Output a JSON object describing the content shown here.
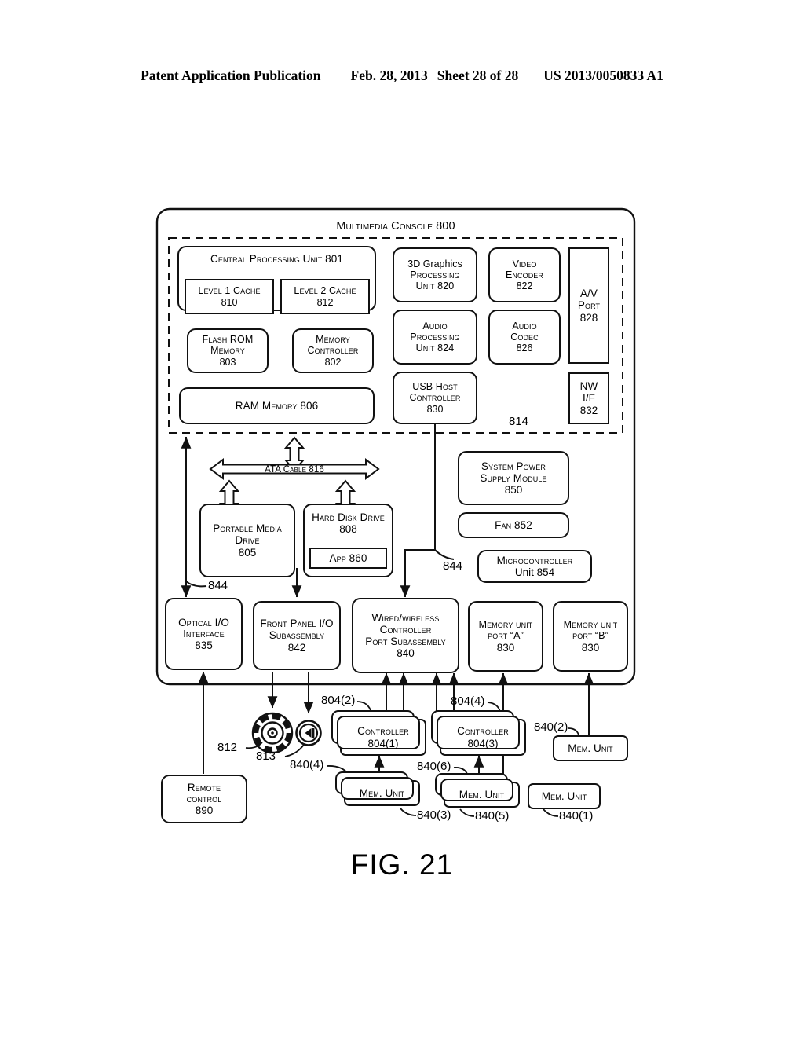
{
  "header": {
    "publication": "Patent Application Publication",
    "date": "Feb. 28, 2013",
    "sheet": "Sheet 28 of 28",
    "docnum": "US 2013/0050833 A1"
  },
  "figure": {
    "caption": "FIG. 21"
  },
  "diagram": {
    "title": "Multimedia Console 800",
    "soc_label": "814",
    "boxes": {
      "cpu": {
        "l1": "Central Processing Unit 801"
      },
      "l1cache": {
        "l1": "Level 1 Cache",
        "l2": "810"
      },
      "l2cache": {
        "l1": "Level 2 Cache",
        "l2": "812"
      },
      "flashrom": {
        "l1": "Flash ROM",
        "l2": "Memory",
        "l3": "803"
      },
      "memctrl": {
        "l1": "Memory",
        "l2": "Controller",
        "l3": "802"
      },
      "ram": {
        "l1": "RAM Memory 806"
      },
      "gpu": {
        "l1": "3D Graphics",
        "l2": "Processing",
        "l3": "Unit 820"
      },
      "videoenc": {
        "l1": "Video",
        "l2": "Encoder",
        "l3": "822"
      },
      "audioproc": {
        "l1": "Audio",
        "l2": "Processing",
        "l3": "Unit 824"
      },
      "audiocodec": {
        "l1": "Audio",
        "l2": "Codec",
        "l3": "826"
      },
      "usbhost": {
        "l1": "USB Host",
        "l2": "Controller",
        "l3": "830"
      },
      "avport": {
        "l1": "A/V",
        "l2": "Port",
        "l3": "828"
      },
      "nwif": {
        "l1": "NW",
        "l2": "I/F",
        "l3": "832"
      },
      "atacable": {
        "l1": "ATA Cable 816"
      },
      "pmd": {
        "l1": "Portable Media",
        "l2": "Drive",
        "l3": "805"
      },
      "hdd": {
        "l1": "Hard Disk Drive",
        "l2": "808"
      },
      "app": {
        "l1": "App 860"
      },
      "psu": {
        "l1": "System Power",
        "l2": "Supply Module",
        "l3": "850"
      },
      "fan": {
        "l1": "Fan 852"
      },
      "mcu": {
        "l1": "Microcontroller",
        "l2": "Unit 854"
      },
      "optical": {
        "l1": "Optical I/O",
        "l2": "Interface",
        "l3": "835"
      },
      "frontpanel": {
        "l1": "Front Panel I/O",
        "l2": "Subassembly",
        "l3": "842"
      },
      "wired": {
        "l1": "Wired/wireless",
        "l2": "Controller",
        "l3": "Port Subassembly",
        "l4": "840"
      },
      "memporta": {
        "l1": "Memory unit",
        "l2": "port “A”",
        "l3": "830"
      },
      "memportb": {
        "l1": "Memory unit",
        "l2": "port “B”",
        "l3": "830"
      },
      "controller1": {
        "l1": "Controller",
        "l2": "804(1)"
      },
      "controller3": {
        "l1": "Controller",
        "l2": "804(3)"
      },
      "memunit1": {
        "l1": "Mem. Unit"
      },
      "memunit2": {
        "l1": "Mem. Unit"
      },
      "memunit3": {
        "l1": "Mem. Unit"
      },
      "memunit4": {
        "l1": "Mem. Unit"
      },
      "remote": {
        "l1": "Remote",
        "l2": "control",
        "l3": "890"
      }
    },
    "ref_labels": {
      "ref_844_left": "844",
      "ref_844_mid": "844",
      "ref_812": "812",
      "ref_813": "813",
      "ref_804_2": "804(2)",
      "ref_804_4": "804(4)",
      "ref_840_1": "840(1)",
      "ref_840_2": "840(2)",
      "ref_840_3": "840(3)",
      "ref_840_4": "840(4)",
      "ref_840_5": "840(5)",
      "ref_840_6": "840(6)"
    },
    "icons": {
      "disc": "optical-disc-icon",
      "media": "media-eject-icon"
    },
    "colors": {
      "stroke": "#111111",
      "fill": "#ffffff"
    }
  }
}
